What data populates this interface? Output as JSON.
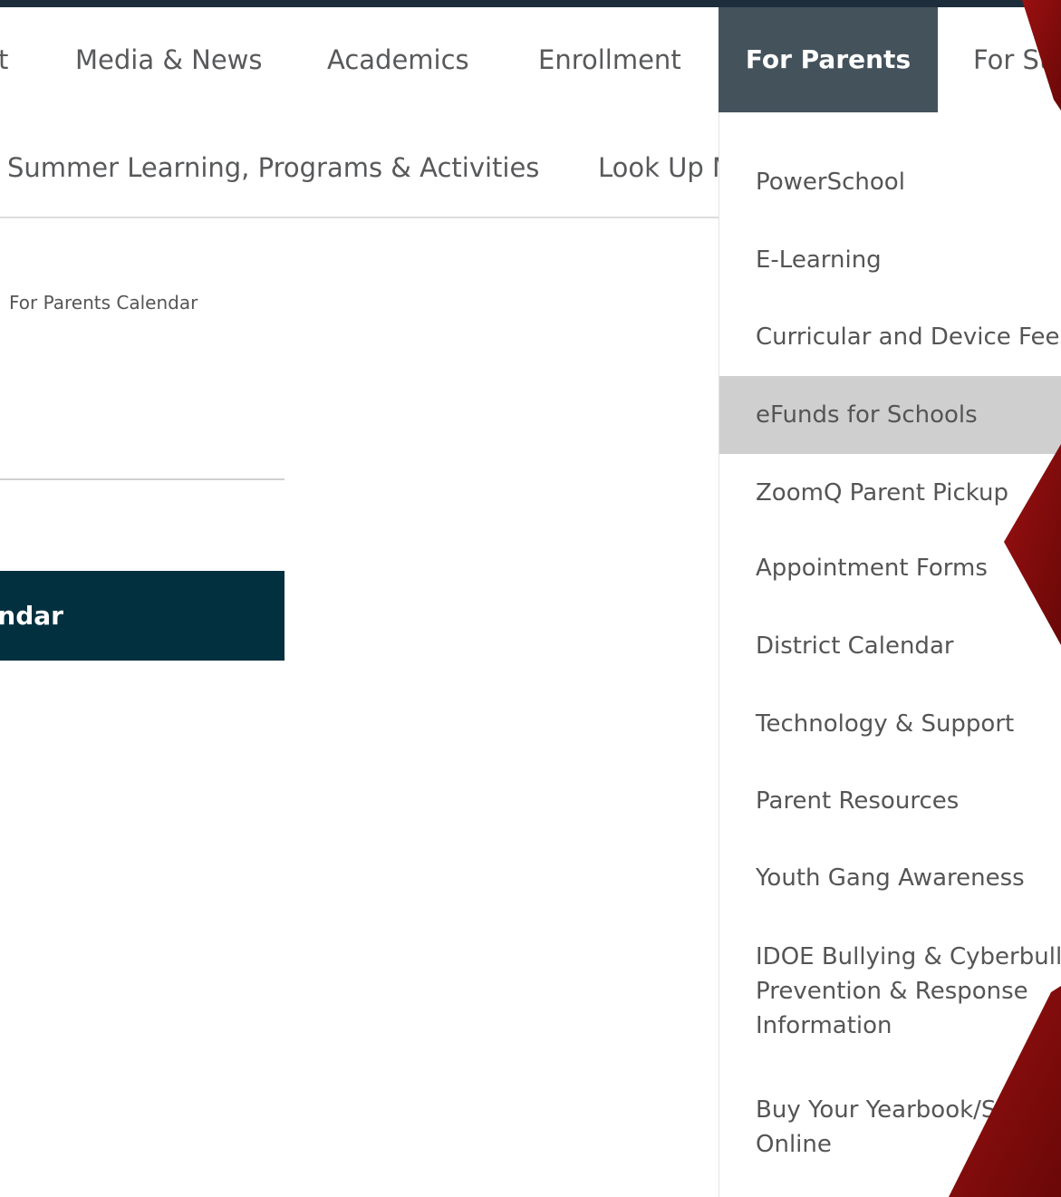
{
  "nav": {
    "partial_left": "t",
    "items": [
      "Media & News",
      "Academics",
      "Enrollment",
      "For Parents",
      "For Students"
    ],
    "active": "For Parents"
  },
  "sub_nav": {
    "items": [
      "Summer Learning, Programs & Activities",
      "Look Up My School"
    ]
  },
  "breadcrumb": "For Parents Calendar",
  "calendar_bar_label": "For Parents Calendar",
  "dropdown": {
    "items": [
      "PowerSchool",
      "E-Learning",
      "Curricular and Device Fees",
      "eFunds for Schools",
      "ZoomQ Parent Pickup",
      "Appointment Forms",
      "District Calendar",
      "Technology & Support",
      "Parent Resources",
      "Youth Gang Awareness",
      [
        "IDOE Bullying & Cyberbullying",
        "Prevention & Response",
        "Information"
      ],
      [
        "Buy Your Yearbook/Senior Ad",
        "Online"
      ]
    ],
    "highlighted": "eFunds for Schools"
  },
  "colors": {
    "active_tab": "#44525c",
    "calendar_bar": "#03303f",
    "highlight_row": "#cfcfcf",
    "accent_red": "#8b0e0e",
    "top_strip": "#1d2d3c"
  }
}
